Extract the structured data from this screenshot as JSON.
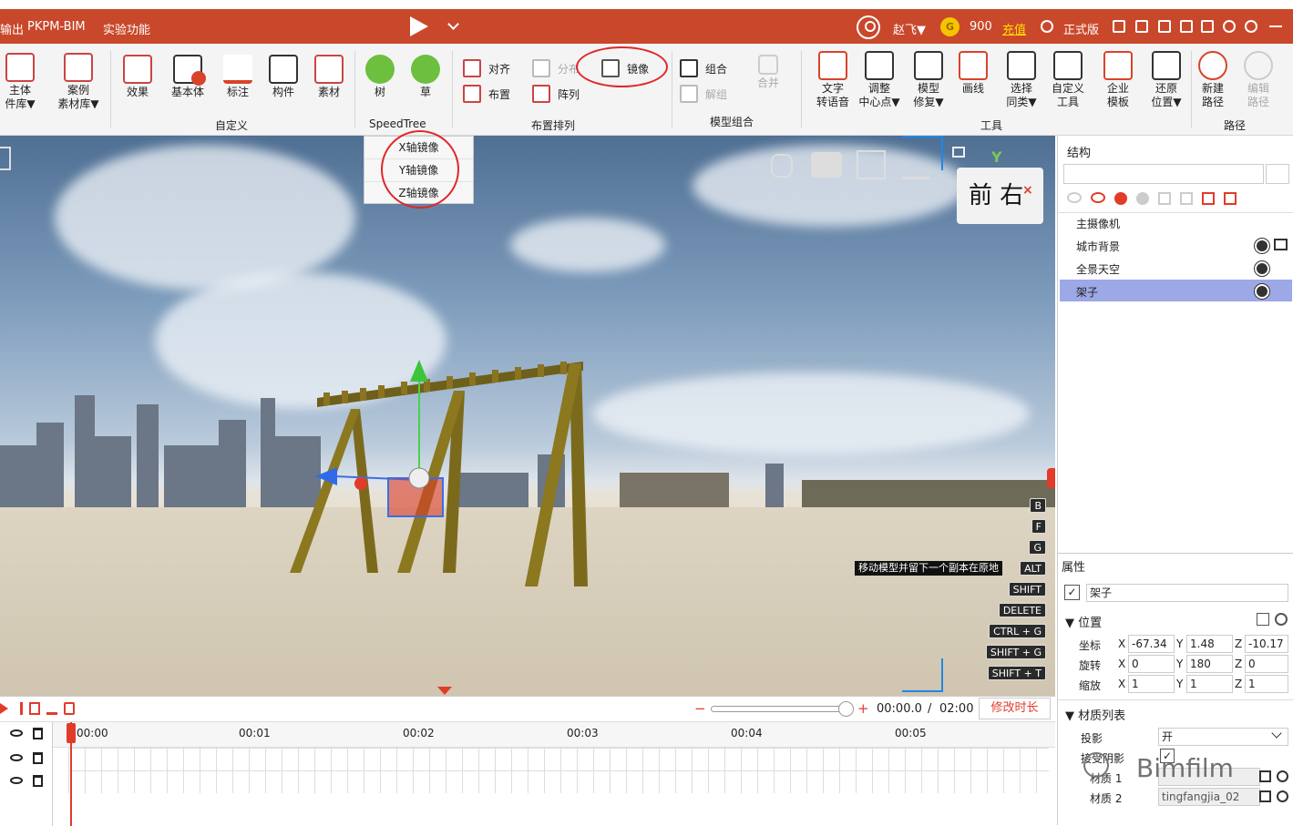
{
  "titlebar": {
    "menu": [
      "输出",
      "PKPM-BIM",
      "实验功能"
    ],
    "user": "赵飞▼",
    "coins": "900",
    "recharge": "充值",
    "edition": "正式版",
    "coin_icon": "G"
  },
  "ribbon": {
    "groups": {
      "custom": "自定义",
      "speedtree": "SpeedTree",
      "layout": "布置排列",
      "model_group": "模型组合",
      "tools": "工具",
      "path": "路径"
    },
    "left": [
      {
        "label1": "主体",
        "label2": "件库▼"
      },
      {
        "label1": "案例",
        "label2": "素材库▼"
      }
    ],
    "custom": [
      "效果",
      "基本体",
      "标注",
      "构件",
      "素材"
    ],
    "speedtree": [
      "树",
      "草"
    ],
    "layout": {
      "align": "对齐",
      "distribute": "分布",
      "mirror": "镜像",
      "place": "布置",
      "array": "阵列"
    },
    "model_group": {
      "group": "组合",
      "ungroup": "解组",
      "merge": "合并"
    },
    "tools": [
      {
        "l1": "文字",
        "l2": "转语音"
      },
      {
        "l1": "调整",
        "l2": "中心点▼"
      },
      {
        "l1": "模型",
        "l2": "修复▼"
      },
      {
        "l1": "画线",
        "l2": ""
      },
      {
        "l1": "选择",
        "l2": "同类▼"
      },
      {
        "l1": "自定义",
        "l2": "工具"
      },
      {
        "l1": "企业",
        "l2": "模板"
      },
      {
        "l1": "还原",
        "l2": "位置▼"
      }
    ],
    "path": [
      {
        "l1": "新建",
        "l2": "路径"
      },
      {
        "l1": "编辑",
        "l2": "路径"
      }
    ]
  },
  "mirror_menu": [
    "X轴镜像",
    "Y轴镜像",
    "Z轴镜像"
  ],
  "viewport": {
    "nav_text": "前 右",
    "axis_y": "Y",
    "hint": "移动模型并留下一个副本在原地",
    "keys": [
      "B",
      "F",
      "G",
      "ALT",
      "SHIFT",
      "DELETE",
      "CTRL + G",
      "SHIFT + G",
      "SHIFT + T"
    ]
  },
  "timeline": {
    "current": "00:00.0",
    "sep": "/",
    "total": "02:00",
    "edit_duration": "修改时长",
    "ticks": [
      "00:00",
      "00:01",
      "00:02",
      "00:03",
      "00:04",
      "00:05"
    ],
    "minus": "−",
    "plus": "+"
  },
  "structure": {
    "title": "结构",
    "search_placeholder": "",
    "items": [
      "主摄像机",
      "城市背景",
      "全景天空",
      "架子"
    ]
  },
  "properties": {
    "title": "属性",
    "name": "架子",
    "position_title": "位置",
    "rows": [
      {
        "label": "坐标",
        "x": "-67.34",
        "y": "1.48",
        "z": "-10.17"
      },
      {
        "label": "旋转",
        "x": "0",
        "y": "180",
        "z": "0"
      },
      {
        "label": "缩放",
        "x": "1",
        "y": "1",
        "z": "1"
      }
    ],
    "axes": [
      "X",
      "Y",
      "Z"
    ],
    "material_title": "材质列表",
    "cast_shadow_label": "投影",
    "cast_shadow_value": "开",
    "receive_shadow_label": "接受阴影",
    "material1_label": "材质 1",
    "material2_label": "材质 2",
    "material2_value": "tingfangjia_02",
    "watermark": "Bimfilm"
  }
}
